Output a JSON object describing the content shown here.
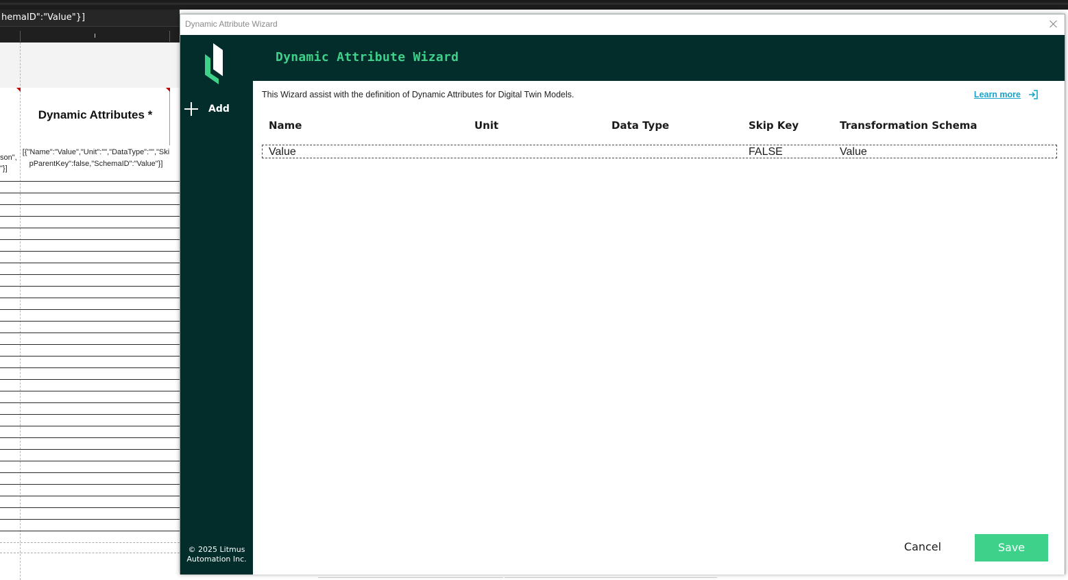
{
  "background": {
    "formula_bar_text": "hemaID\":\"Value\"}]",
    "column_title": "Dynamic Attributes *",
    "left_cell_snippet": "son\",\n\"}]",
    "json_cell": "[{\"Name\":\"Value\",\"Unit\":\"\",\"DataType\":\"\",\"SkipParentKey\":false,\"SchemaID\":\"Value\"}]"
  },
  "dialog": {
    "window_title": "Dynamic Attribute Wizard",
    "header_title": "Dynamic Attribute Wizard",
    "description": "This Wizard assist with the definition of Dynamic Attributes for Digital Twin Models.",
    "learn_more": "Learn more",
    "sidebar": {
      "add_label": "Add",
      "copyright": "© 2025 Litmus Automation Inc."
    },
    "table": {
      "columns": [
        "Name",
        "Unit",
        "Data Type",
        "Skip Key",
        "Transformation Schema"
      ],
      "rows": [
        {
          "name": "Value",
          "unit": "",
          "data_type": "",
          "skip_key": "FALSE",
          "schema": "Value"
        }
      ]
    },
    "buttons": {
      "cancel": "Cancel",
      "save": "Save"
    }
  },
  "colors": {
    "sidebar_bg": "#022d2b",
    "accent": "#3ed18a",
    "link": "#1aa3c9"
  },
  "icons": [
    "litmus-logo-icon",
    "plus-icon",
    "external-link-icon",
    "close-icon"
  ]
}
